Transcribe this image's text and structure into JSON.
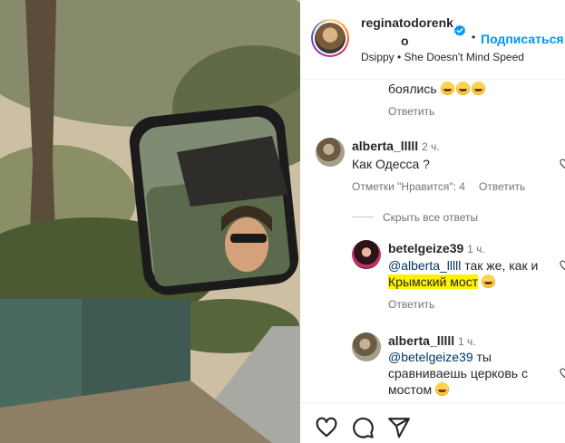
{
  "post": {
    "username_line1": "reginatodorenk",
    "username_line2": "o",
    "follow_label": "Подписаться",
    "audio_line": "Dsippy • She Doesn't Mind Speed",
    "dot": "•"
  },
  "comments": {
    "prev_tail_text": "боялись",
    "prev_reply_label": "Ответить",
    "c1": {
      "author": "alberta_lllll",
      "time": "2 ч.",
      "text": "Как Одесса ?",
      "likes_label": "Отметки \"Нравится\": 4",
      "reply_label": "Ответить"
    },
    "hide_replies_label": "Скрыть все ответы",
    "r1": {
      "author": "betelgeize39",
      "time": "1 ч.",
      "mention": "@alberta_lllll",
      "text_a": "так же, как и",
      "highlight": "Крымский мост",
      "reply_label": "Ответить"
    },
    "r2": {
      "author": "alberta_lllll",
      "time": "1 ч.",
      "mention": "@betelgeize39",
      "text_a": "ты",
      "text_b": "сравниваешь церковь с",
      "text_c": "мостом"
    }
  },
  "icons": [
    "heart-icon",
    "comment-icon",
    "share-icon",
    "verified-icon"
  ],
  "colors": {
    "link": "#0095f6",
    "mention": "#00376b",
    "highlight": "#fff100",
    "meta": "#737373"
  }
}
